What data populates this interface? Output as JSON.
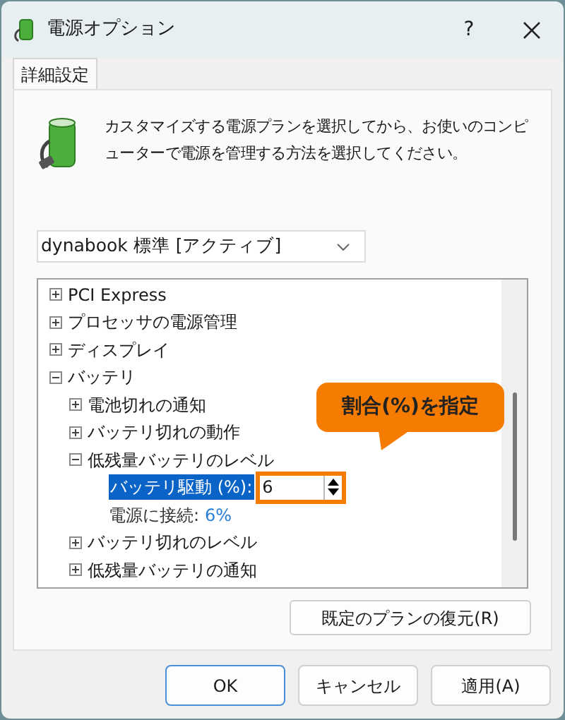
{
  "window": {
    "title": "電源オプション",
    "help": "?"
  },
  "tabs": [
    {
      "label": "詳細設定",
      "selected": true
    }
  ],
  "description": "カスタマイズする電源プランを選択してから、お使いのコンピューターで電源を管理する方法を選択してください。",
  "plan_dropdown": {
    "value": "dynabook 標準 [アクティブ]"
  },
  "tree": [
    {
      "kind": "group",
      "label": "PCI Express",
      "expanded": false
    },
    {
      "kind": "group",
      "label": "プロセッサの電源管理",
      "expanded": false
    },
    {
      "kind": "group",
      "label": "ディスプレイ",
      "expanded": false
    },
    {
      "kind": "group",
      "label": "バッテリ",
      "expanded": true,
      "children": [
        {
          "kind": "group",
          "label": "電池切れの通知",
          "expanded": false
        },
        {
          "kind": "group",
          "label": "バッテリ切れの動作",
          "expanded": false
        },
        {
          "kind": "group",
          "label": "低残量バッテリのレベル",
          "expanded": true,
          "children": [
            {
              "kind": "spin",
              "label": "バッテリ駆動 (%):",
              "value": "6",
              "selected": true
            },
            {
              "kind": "value",
              "label": "電源に接続:",
              "value": "6%",
              "selected": false
            }
          ]
        },
        {
          "kind": "group",
          "label": "バッテリ切れのレベル",
          "expanded": false
        },
        {
          "kind": "group",
          "label": "低残量バッテリの通知",
          "expanded": false
        }
      ]
    }
  ],
  "callout": "割合(%)を指定",
  "restore_button": "既定のプランの復元(R)",
  "buttons": [
    {
      "label": "OK",
      "default": true
    },
    {
      "label": "キャンセル",
      "default": false
    },
    {
      "label": "適用(A)",
      "default": false
    }
  ]
}
